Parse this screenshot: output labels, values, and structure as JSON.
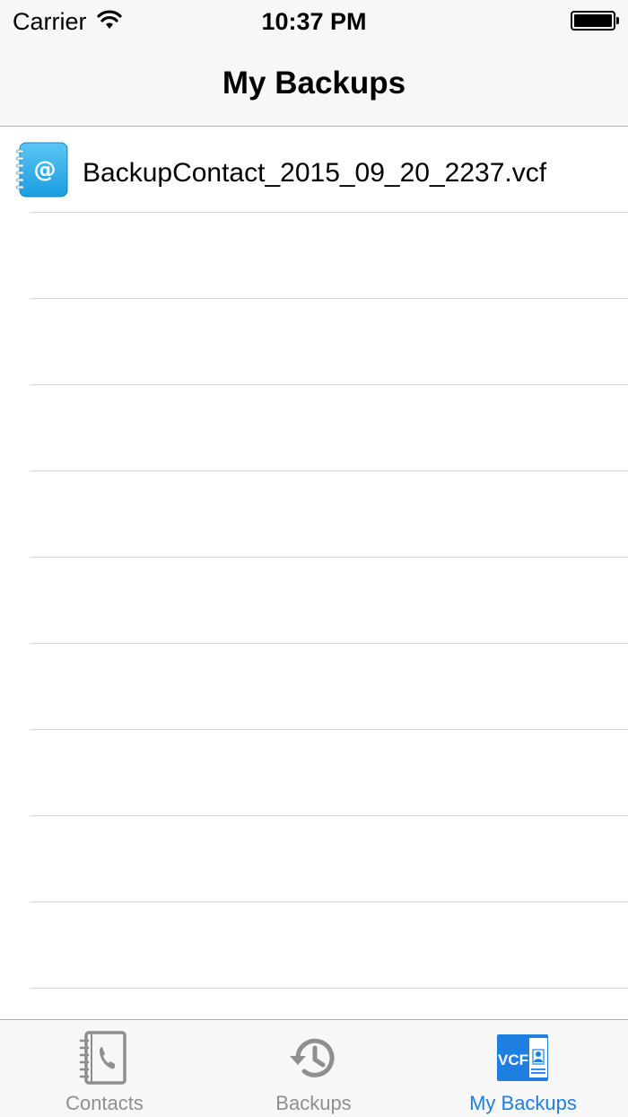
{
  "status_bar": {
    "carrier": "Carrier",
    "time": "10:37 PM",
    "wifi_icon": "wifi-icon",
    "battery_icon": "battery-icon",
    "battery_level": 1.0
  },
  "nav": {
    "title": "My Backups"
  },
  "backups": {
    "files": [
      {
        "name": "BackupContact_2015_09_20_2237.vcf",
        "icon": "address-book-icon"
      }
    ]
  },
  "tab_bar": {
    "tabs": [
      {
        "label": "Contacts",
        "icon": "contacts-book-icon",
        "active": false
      },
      {
        "label": "Backups",
        "icon": "history-icon",
        "active": false
      },
      {
        "label": "My Backups",
        "icon": "vcf-file-icon",
        "active": true
      }
    ]
  },
  "colors": {
    "accent": "#1e7fe0",
    "inactive": "#8e8e93",
    "bar_background": "#f7f7f7",
    "separator": "#d6d6db"
  }
}
